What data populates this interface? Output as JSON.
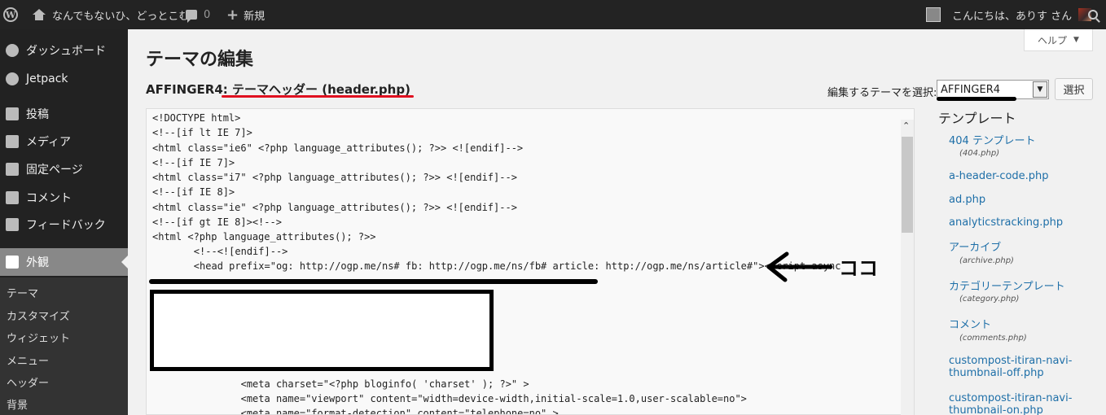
{
  "admin_bar": {
    "site_name": "なんでもないひ、どっとこむ",
    "comment_count": "0",
    "new_label": "新規",
    "howdy": "こんにちは、ありす さん"
  },
  "sidebar": {
    "items": [
      {
        "label": "ダッシュボード",
        "icon": "dashboard-icon"
      },
      {
        "label": "Jetpack",
        "icon": "jetpack-icon"
      },
      {
        "label": "投稿",
        "icon": "pin-icon"
      },
      {
        "label": "メディア",
        "icon": "media-icon"
      },
      {
        "label": "固定ページ",
        "icon": "page-icon"
      },
      {
        "label": "コメント",
        "icon": "comment-icon"
      },
      {
        "label": "フィードバック",
        "icon": "feedback-icon"
      },
      {
        "label": "外観",
        "icon": "appearance-icon"
      }
    ],
    "submenu": [
      "テーマ",
      "カスタマイズ",
      "ウィジェット",
      "メニュー",
      "ヘッダー",
      "背景"
    ]
  },
  "help_label": "ヘルプ",
  "page_title": "テーマの編集",
  "file_heading": {
    "theme": "AFFINGER4:",
    "file": "テーマヘッダー (header.php)"
  },
  "theme_select": {
    "label": "編集するテーマを選択:",
    "value": "AFFINGER4",
    "button": "選択"
  },
  "code_lines": [
    "<!DOCTYPE html>",
    "<!--[if lt IE 7]>",
    "<html class=\"ie6\" <?php language_attributes(); ?>> <![endif]-->",
    "<!--[if IE 7]>",
    "<html class=\"i7\" <?php language_attributes(); ?>> <![endif]-->",
    "<!--[if IE 8]>",
    "<html class=\"ie\" <?php language_attributes(); ?>> <![endif]-->",
    "<!--[if gt IE 8]><!-->",
    "<html <?php language_attributes(); ?>>",
    "\t<!--<![endif]-->",
    "\t<head prefix=\"og: http://ogp.me/ns# fb: http://ogp.me/ns/fb# article: http://ogp.me/ns/article#\"><script async",
    "\t\t<meta charset=\"<?php bloginfo( 'charset' ); ?>\" >",
    "\t\t<meta name=\"viewport\" content=\"width=device-width,initial-scale=1.0,user-scalable=no\">",
    "\t\t<meta name=\"format-detection\" content=\"telephone=no\" >"
  ],
  "annotation": "ココ",
  "templates": {
    "heading": "テンプレート",
    "items": [
      {
        "name": "404 テンプレート",
        "file": "(404.php)"
      },
      {
        "name": "a-header-code.php",
        "file": ""
      },
      {
        "name": "ad.php",
        "file": ""
      },
      {
        "name": "analyticstracking.php",
        "file": ""
      },
      {
        "name": "アーカイブ",
        "file": "(archive.php)"
      },
      {
        "name": "カテゴリーテンプレート",
        "file": "(category.php)"
      },
      {
        "name": "コメント",
        "file": "(comments.php)"
      },
      {
        "name": "custompost-itiran-navi-",
        "name2": "thumbnail-off.php",
        "file": ""
      },
      {
        "name": "custompost-itiran-navi-",
        "name2": "thumbnail-on.php",
        "file": ""
      }
    ]
  },
  "colors": {
    "admin_bar": "#232323",
    "sidebar": "#222222",
    "current_menu": "#888888",
    "link": "#1e6fa8",
    "red_mark": "#e01020"
  }
}
